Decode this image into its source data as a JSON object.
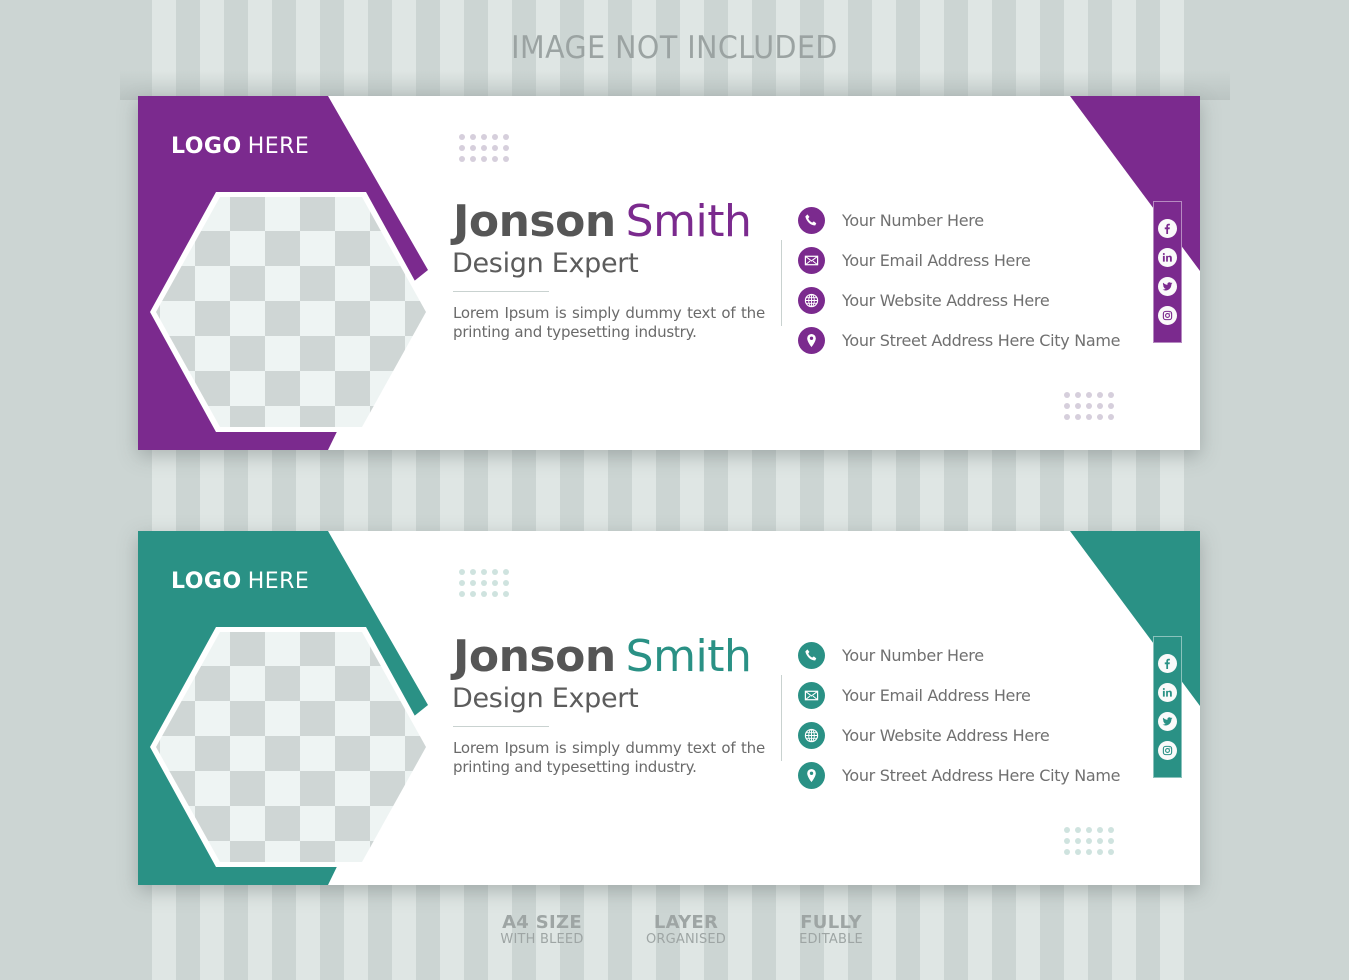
{
  "header": {
    "text": "IMAGE NOT INCLUDED"
  },
  "cards": [
    {
      "theme": "purple",
      "accent": "#7b2a8e",
      "dot_color": "#d6cfdc",
      "logo": {
        "bold": "LOGO",
        "thin": "HERE"
      },
      "photo_placeholder": "hexagon-checkerboard",
      "name": {
        "first": "Jonson",
        "last": "Smith"
      },
      "job_title": "Design Expert",
      "description": "Lorem Ipsum is simply dummy text of the printing and typesetting industry.",
      "contacts": [
        {
          "icon": "phone-icon",
          "text": "Your Number Here"
        },
        {
          "icon": "email-icon",
          "text": "Your Email Address Here"
        },
        {
          "icon": "globe-icon",
          "text": "Your Website Address Here"
        },
        {
          "icon": "location-pin-icon",
          "text": "Your Street Address Here City Name"
        }
      ],
      "social": [
        "facebook-icon",
        "linkedin-icon",
        "twitter-icon",
        "instagram-icon"
      ]
    },
    {
      "theme": "teal",
      "accent": "#2a9185",
      "dot_color": "#cfe3df",
      "logo": {
        "bold": "LOGO",
        "thin": "HERE"
      },
      "photo_placeholder": "hexagon-checkerboard",
      "name": {
        "first": "Jonson",
        "last": "Smith"
      },
      "job_title": "Design Expert",
      "description": "Lorem Ipsum is simply dummy text of the printing and typesetting industry.",
      "contacts": [
        {
          "icon": "phone-icon",
          "text": "Your Number Here"
        },
        {
          "icon": "email-icon",
          "text": "Your Email Address Here"
        },
        {
          "icon": "globe-icon",
          "text": "Your Website Address Here"
        },
        {
          "icon": "location-pin-icon",
          "text": "Your Street Address Here City Name"
        }
      ],
      "social": [
        "facebook-icon",
        "linkedin-icon",
        "twitter-icon",
        "instagram-icon"
      ]
    }
  ],
  "footer": [
    {
      "big": "A4 SIZE",
      "small": "WITH BLEED"
    },
    {
      "big": "LAYER",
      "small": "ORGANISED"
    },
    {
      "big": "FULLY",
      "small": "EDITABLE"
    }
  ],
  "colors": {
    "background": "#ccd5d3",
    "stripe_light": "#dfe6e4",
    "text_dark": "#565656",
    "text_muted": "#707070",
    "checker_dark": "#cfd6d5",
    "checker_light": "#eef4f3"
  }
}
